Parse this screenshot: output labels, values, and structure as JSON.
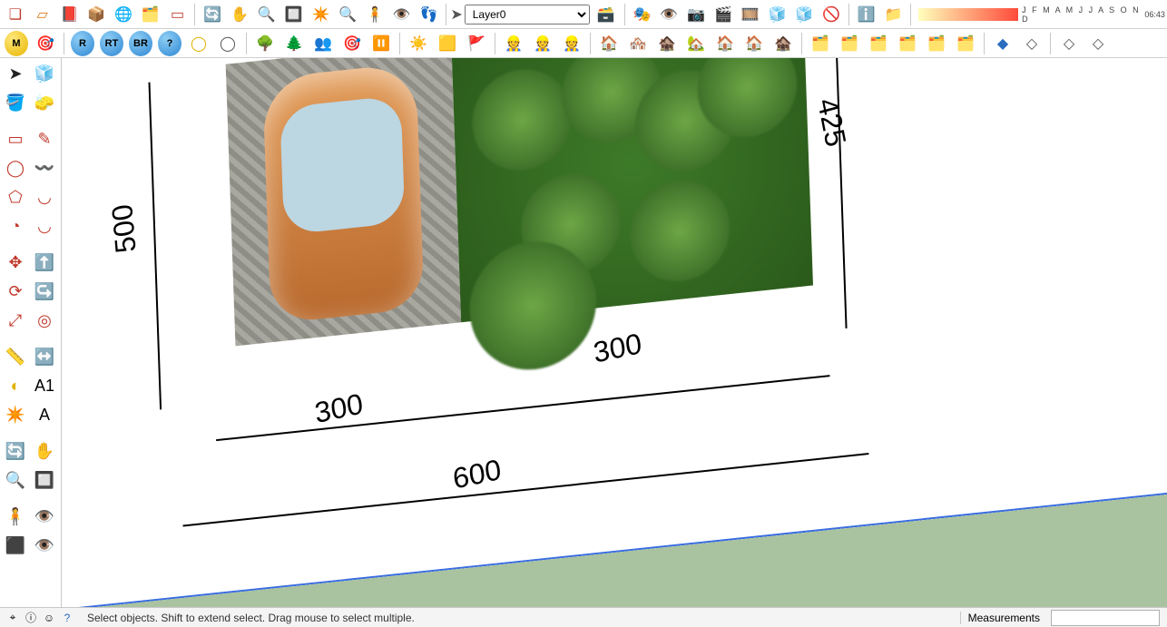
{
  "layer": "Layer0",
  "months": "J F M A M J J A S O N D",
  "clock": "06:43",
  "plan": {
    "dim_left": "500",
    "dim_right": "425",
    "dim_bottom_1": "300",
    "dim_bottom_2": "300",
    "dim_total": "600"
  },
  "status": {
    "hint": "Select objects. Shift to extend select. Drag mouse to select multiple.",
    "measurements_label": "Measurements",
    "measurements_value": ""
  }
}
